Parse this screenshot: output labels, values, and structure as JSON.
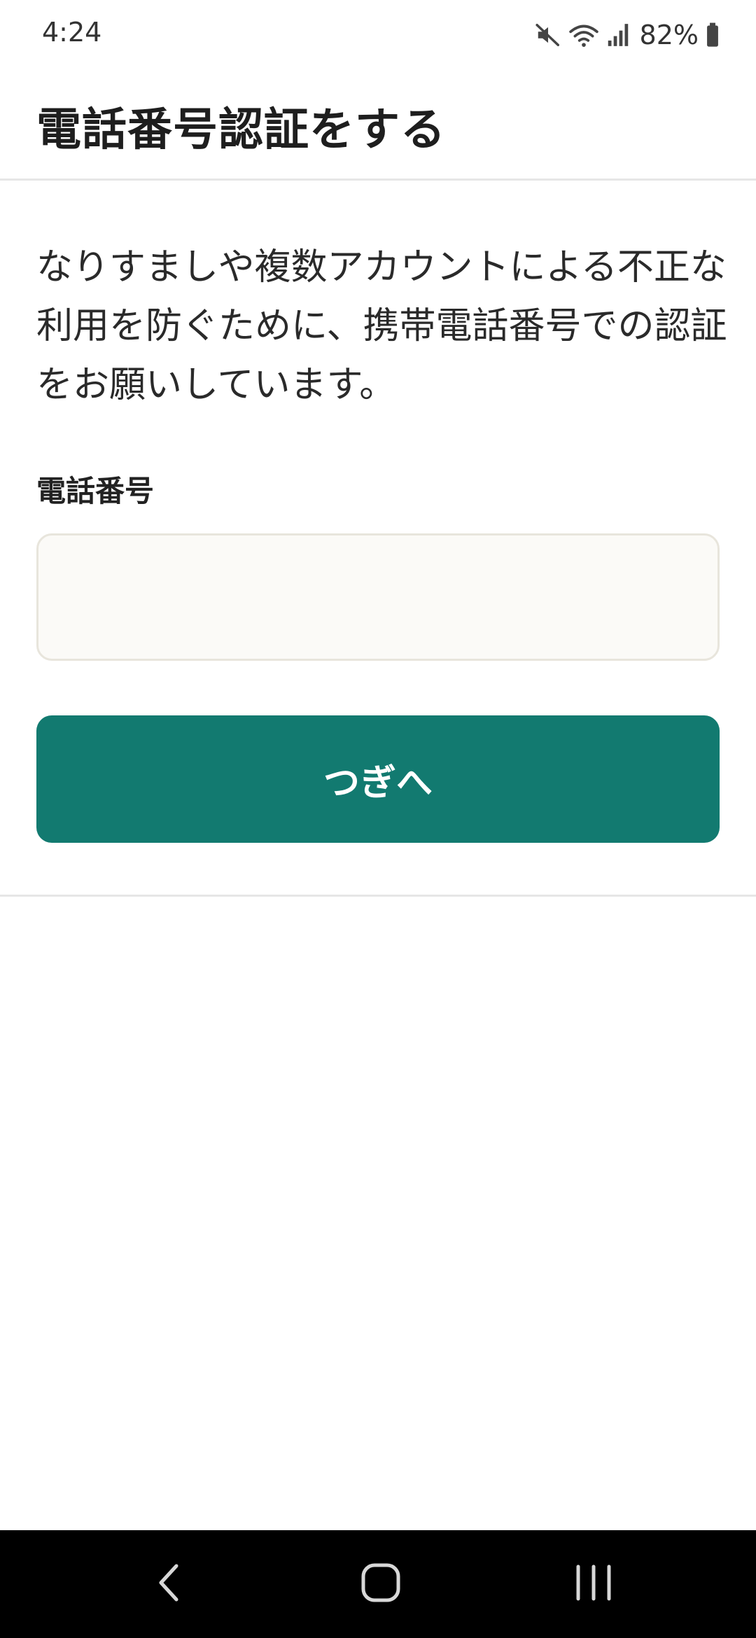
{
  "status_bar": {
    "time": "4:24",
    "battery": "82%",
    "icons": [
      "mute-icon",
      "wifi-icon",
      "signal-icon",
      "battery-icon"
    ]
  },
  "header": {
    "title": "電話番号認証をする"
  },
  "main": {
    "description": "なりすましや複数アカウントによる不正な利用を防ぐために、携帯電話番号での認証をお願いしています。",
    "phone_label": "電話番号",
    "phone_value": "",
    "phone_placeholder": "",
    "next_label": "つぎへ"
  },
  "nav_bar": {
    "icons": [
      "back-icon",
      "home-icon",
      "recents-icon"
    ]
  },
  "colors": {
    "accent": "#127a70",
    "input_bg": "#fbfaf7",
    "input_border": "#e8e5dc",
    "divider": "#e6e6e6"
  }
}
